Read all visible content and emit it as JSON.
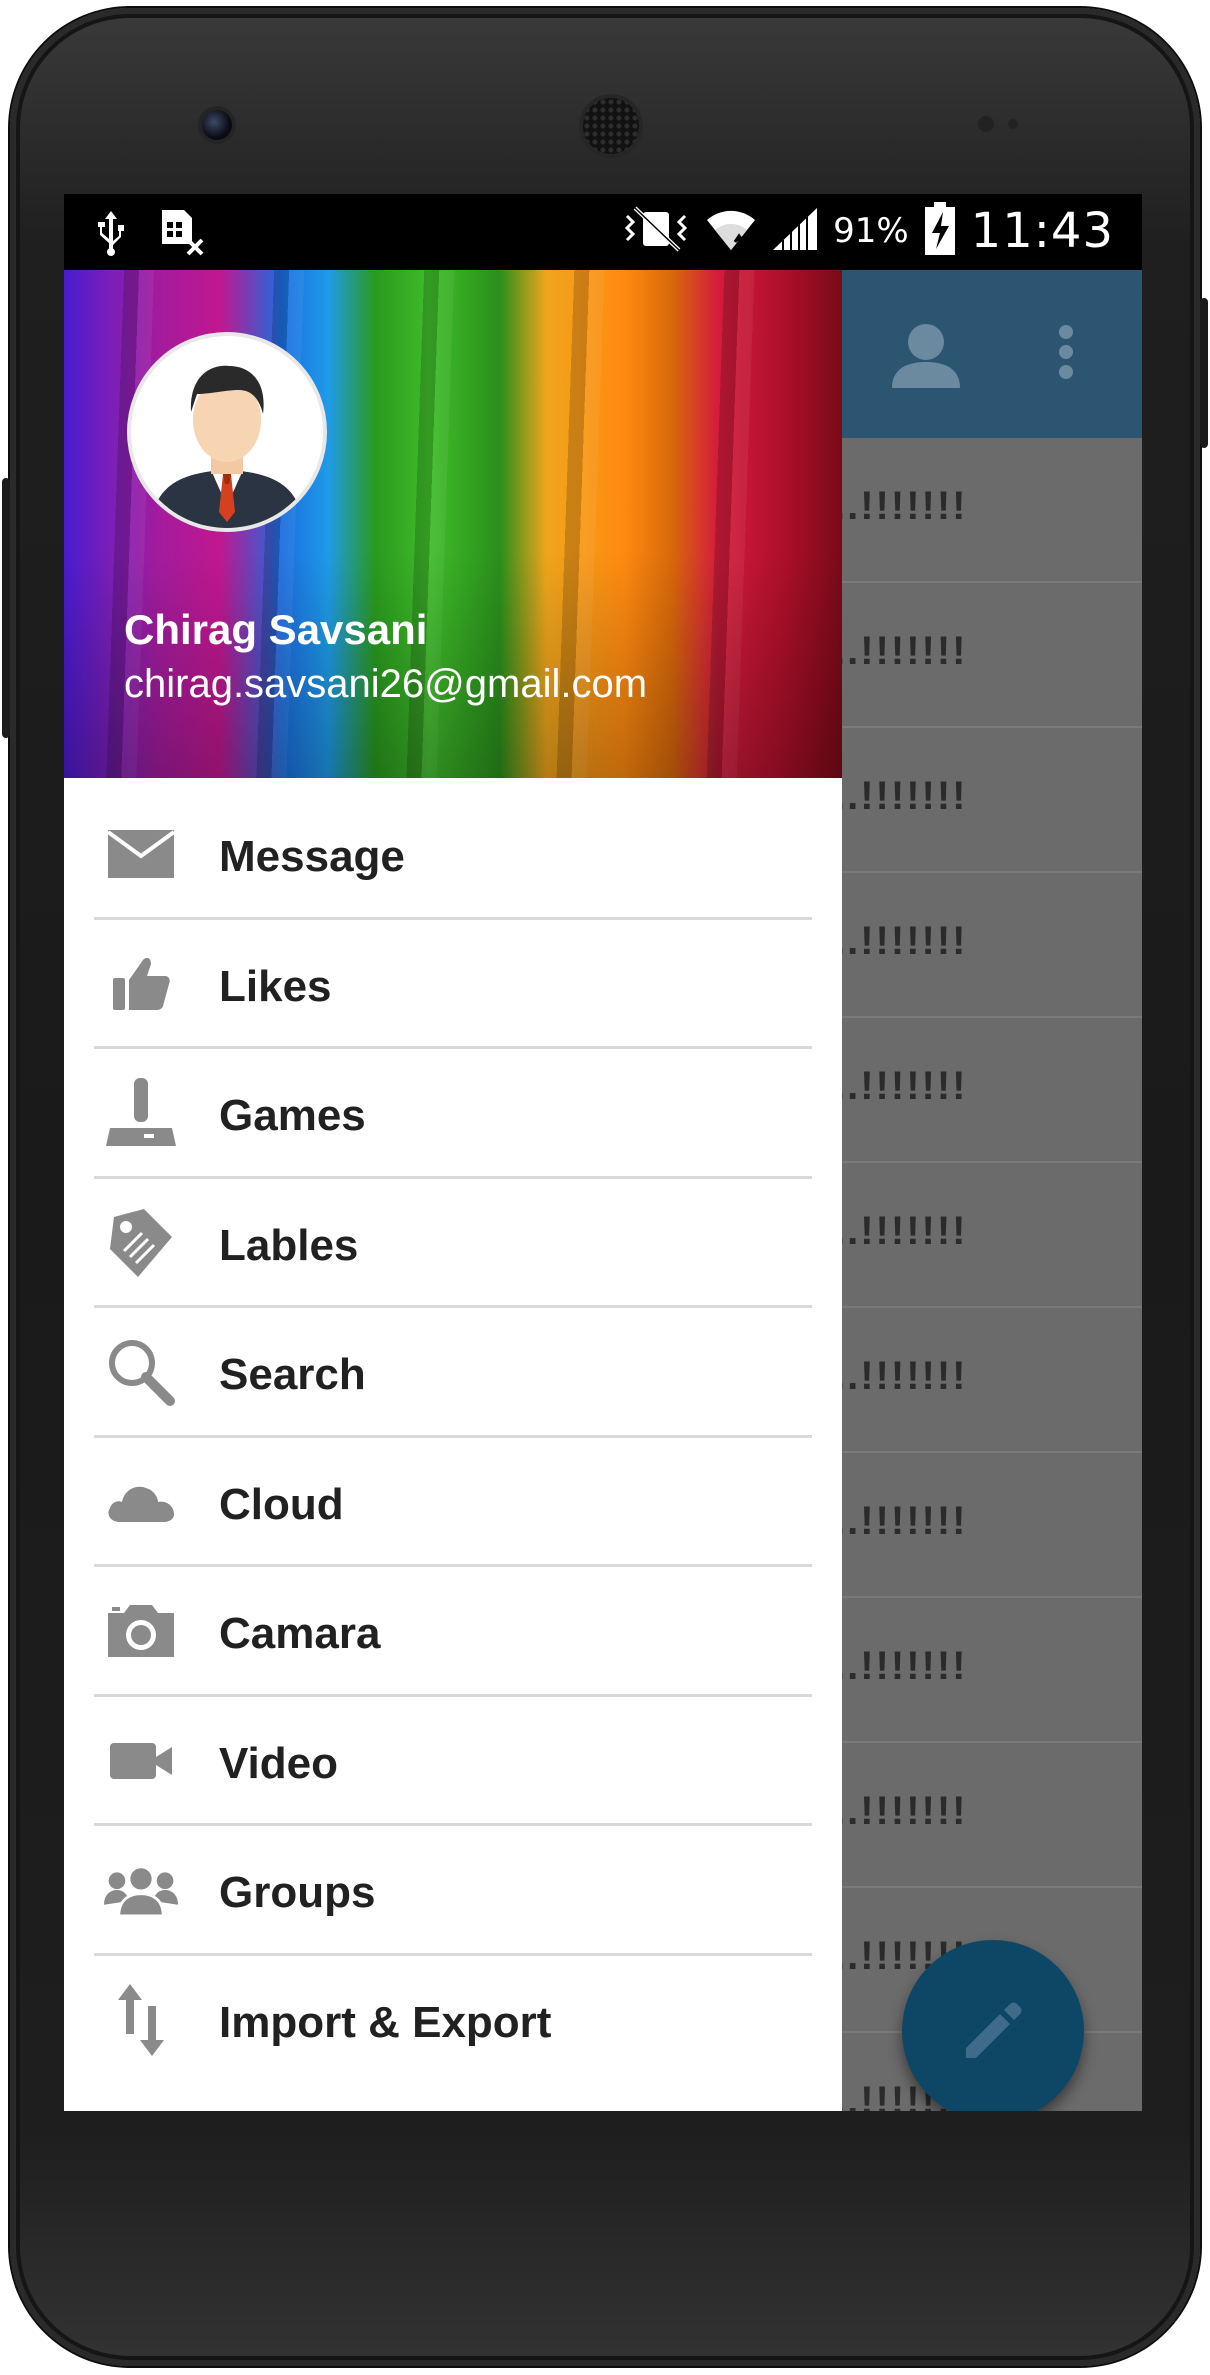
{
  "status_bar": {
    "battery": "91%",
    "time": "11:43"
  },
  "drawer": {
    "user_name": "Chirag Savsani",
    "user_email": "chirag.savsani26@gmail.com",
    "items": [
      {
        "label": "Message",
        "icon": "mail-icon"
      },
      {
        "label": "Likes",
        "icon": "thumbs-up-icon"
      },
      {
        "label": "Games",
        "icon": "joystick-icon"
      },
      {
        "label": "Lables",
        "icon": "tag-icon"
      },
      {
        "label": "Search",
        "icon": "search-icon"
      },
      {
        "label": "Cloud",
        "icon": "cloud-icon"
      },
      {
        "label": "Camara",
        "icon": "camera-icon"
      },
      {
        "label": "Video",
        "icon": "video-camera-icon"
      },
      {
        "label": "Groups",
        "icon": "group-icon"
      },
      {
        "label": "Import & Export",
        "icon": "import-export-icon"
      }
    ]
  },
  "background_list": {
    "row_text": "..!!!!!!!",
    "rows": 12
  },
  "colors": {
    "app_bar": "#2b5570",
    "fab": "#0e4766",
    "scrim": "#6b6b6b",
    "icon_gray": "#8a8a8a"
  }
}
